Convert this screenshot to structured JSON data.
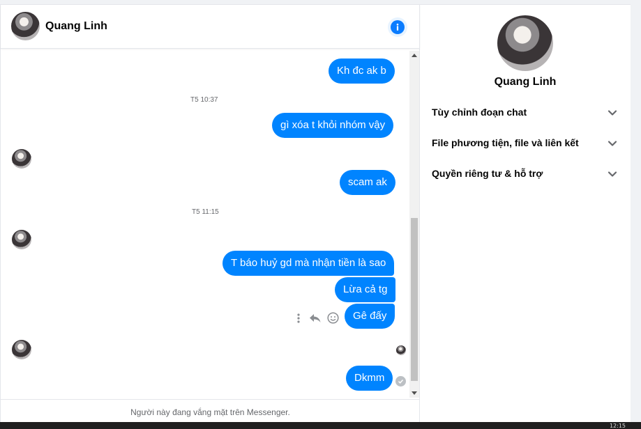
{
  "chat": {
    "contact_name": "Quang Linh",
    "footer_status": "Người này đang vắng mặt trên Messenger.",
    "messages": [
      {
        "text": "Kh đc ak b"
      },
      {
        "text": "gì xóa t khỏi nhóm vậy"
      },
      {
        "text": "scam ak"
      },
      {
        "text": "T báo huỷ gd mà nhận tiền là sao"
      },
      {
        "text": "Lừa cả tg"
      },
      {
        "text": "Gê đấy"
      },
      {
        "text": "Dkmm"
      }
    ],
    "timestamps": [
      "T5 10:37",
      "T5 11:15"
    ]
  },
  "info_panel": {
    "name": "Quang Linh",
    "sections": [
      {
        "label": "Tùy chỉnh đoạn chat"
      },
      {
        "label": "File phương tiện, file và liên kết"
      },
      {
        "label": "Quyền riêng tư & hỗ trợ"
      }
    ]
  },
  "icons": {
    "info": "info-icon",
    "more": "more-vertical-icon",
    "reply": "reply-icon",
    "react": "smile-icon",
    "chevron": "chevron-down-icon",
    "sent": "check-circle-icon"
  },
  "colors": {
    "accent": "#0084ff",
    "info_blue": "#0a7cff",
    "secondary_text": "#65676b"
  },
  "taskbar": {
    "clock": "12:15"
  }
}
